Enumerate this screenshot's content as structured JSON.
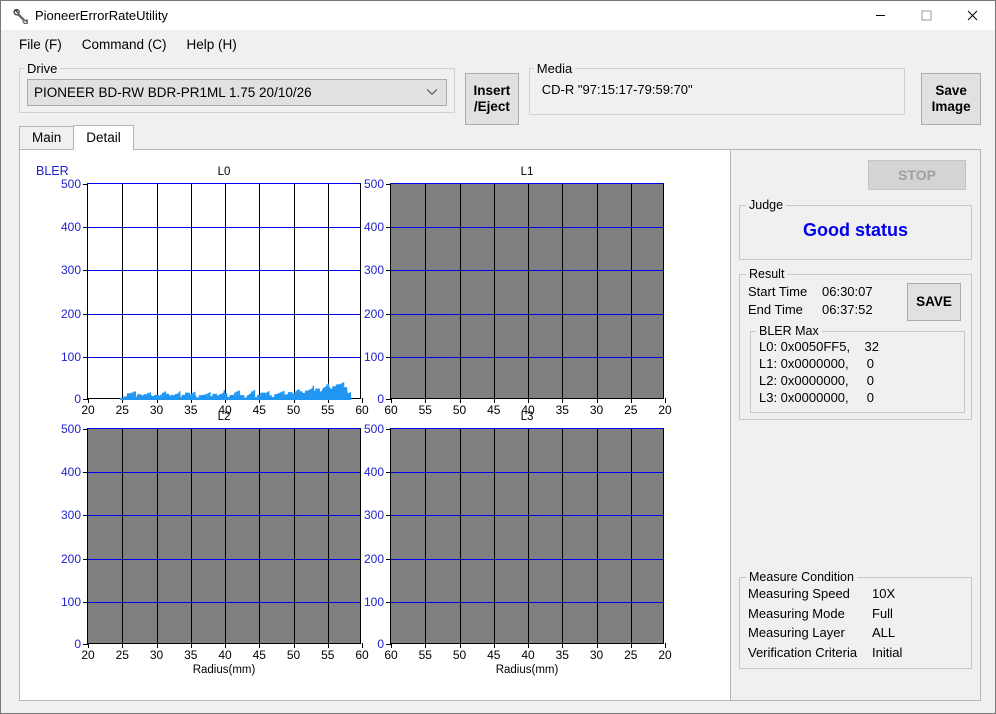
{
  "window": {
    "title": "PioneerErrorRateUtility",
    "app_icon": "wrench-icon",
    "minimize": "—",
    "maximize": "□",
    "close": "✕"
  },
  "menu": {
    "items": [
      {
        "label": "File (F)",
        "name": "menu-file"
      },
      {
        "label": "Command (C)",
        "name": "menu-command"
      },
      {
        "label": "Help (H)",
        "name": "menu-help"
      }
    ]
  },
  "drive": {
    "legend": "Drive",
    "selected": "PIONEER BD-RW  BDR-PR1ML 1.75 20/10/26",
    "chevron": "⌄"
  },
  "buttons": {
    "insert_eject_line1": "Insert",
    "insert_eject_line2": "/Eject",
    "save_image_line1": "Save",
    "save_image_line2": "Image",
    "stop": "STOP",
    "save": "SAVE"
  },
  "media": {
    "legend": "Media",
    "value": "CD-R \"97:15:17-79:59:70\""
  },
  "tabs": [
    {
      "label": "Main",
      "name": "tab-main",
      "active": false
    },
    {
      "label": "Detail",
      "name": "tab-detail",
      "active": true
    }
  ],
  "judge": {
    "legend": "Judge",
    "status": "Good status",
    "color": "#0000ee"
  },
  "result": {
    "legend": "Result",
    "start_time_label": "Start Time",
    "start_time_value": "06:30:07",
    "end_time_label": "End Time",
    "end_time_value": "06:37:52",
    "bler_max_legend": "BLER Max",
    "bler_max_rows": [
      "L0: 0x0050FF5,    32",
      "L1: 0x0000000,     0",
      "L2: 0x0000000,     0",
      "L3: 0x0000000,     0"
    ]
  },
  "measure_condition": {
    "legend": "Measure Condition",
    "rows": [
      {
        "label": "Measuring Speed",
        "value": "10X"
      },
      {
        "label": "Measuring Mode",
        "value": "Full"
      },
      {
        "label": "Measuring Layer",
        "value": "ALL"
      },
      {
        "label": "Verification Criteria",
        "value": "Initial"
      }
    ]
  },
  "chart_data": [
    {
      "id": "L0",
      "type": "area",
      "title": "L0",
      "xlabel": "Radius(mm)",
      "ylabel": "BLER",
      "ylim": [
        0,
        500
      ],
      "yticks": [
        0,
        100,
        200,
        300,
        400,
        500
      ],
      "xlim": [
        20,
        60
      ],
      "xticks": [
        20,
        25,
        30,
        35,
        40,
        45,
        50,
        55,
        60
      ],
      "x_reversed": false,
      "grid": true,
      "disabled": false,
      "data_x_start": 25,
      "data_x_end": 58,
      "peak_value": 32,
      "series": [
        {
          "name": "BLER",
          "color": "#2196f3",
          "x": [
            25.0,
            25.5,
            26.0,
            26.5,
            27.0,
            27.5,
            28.0,
            28.5,
            29.0,
            29.5,
            30.0,
            30.5,
            31.0,
            31.5,
            32.0,
            32.5,
            33.0,
            33.5,
            34.0,
            34.5,
            35.0,
            35.5,
            36.0,
            36.5,
            37.0,
            37.5,
            38.0,
            38.5,
            39.0,
            39.5,
            40.0,
            40.5,
            41.0,
            41.5,
            42.0,
            42.5,
            43.0,
            43.5,
            44.0,
            44.5,
            45.0,
            45.5,
            46.0,
            46.5,
            47.0,
            47.5,
            48.0,
            48.5,
            49.0,
            49.5,
            50.0,
            50.5,
            51.0,
            51.5,
            52.0,
            52.5,
            53.0,
            53.5,
            54.0,
            54.5,
            55.0,
            55.5,
            56.0,
            56.5,
            57.0,
            57.5,
            58.0
          ],
          "values": [
            5,
            9,
            13,
            11,
            8,
            10,
            12,
            9,
            7,
            11,
            10,
            8,
            9,
            12,
            14,
            10,
            8,
            9,
            11,
            13,
            9,
            8,
            10,
            12,
            9,
            7,
            9,
            11,
            10,
            8,
            12,
            9,
            10,
            13,
            11,
            9,
            8,
            10,
            12,
            9,
            11,
            13,
            10,
            9,
            11,
            14,
            12,
            10,
            13,
            15,
            12,
            14,
            16,
            18,
            20,
            19,
            22,
            24,
            21,
            25,
            27,
            29,
            31,
            32,
            30,
            28,
            20
          ]
        }
      ]
    },
    {
      "id": "L1",
      "type": "area",
      "title": "L1",
      "xlabel": "Radius(mm)",
      "ylabel": "BLER",
      "ylim": [
        0,
        500
      ],
      "yticks": [
        0,
        100,
        200,
        300,
        400,
        500
      ],
      "xlim": [
        60,
        20
      ],
      "xticks": [
        60,
        55,
        50,
        45,
        40,
        35,
        30,
        25,
        20
      ],
      "x_reversed": true,
      "grid": true,
      "disabled": true,
      "series": []
    },
    {
      "id": "L2",
      "type": "area",
      "title": "L2",
      "xlabel": "Radius(mm)",
      "ylabel": "BLER",
      "ylim": [
        0,
        500
      ],
      "yticks": [
        0,
        100,
        200,
        300,
        400,
        500
      ],
      "xlim": [
        20,
        60
      ],
      "xticks": [
        20,
        25,
        30,
        35,
        40,
        45,
        50,
        55,
        60
      ],
      "x_reversed": false,
      "grid": true,
      "disabled": true,
      "series": []
    },
    {
      "id": "L3",
      "type": "area",
      "title": "L3",
      "xlabel": "Radius(mm)",
      "ylabel": "BLER",
      "ylim": [
        0,
        500
      ],
      "yticks": [
        0,
        100,
        200,
        300,
        400,
        500
      ],
      "xlim": [
        60,
        20
      ],
      "xticks": [
        60,
        55,
        50,
        45,
        40,
        35,
        30,
        25,
        20
      ],
      "x_reversed": true,
      "grid": true,
      "disabled": true,
      "series": []
    }
  ]
}
